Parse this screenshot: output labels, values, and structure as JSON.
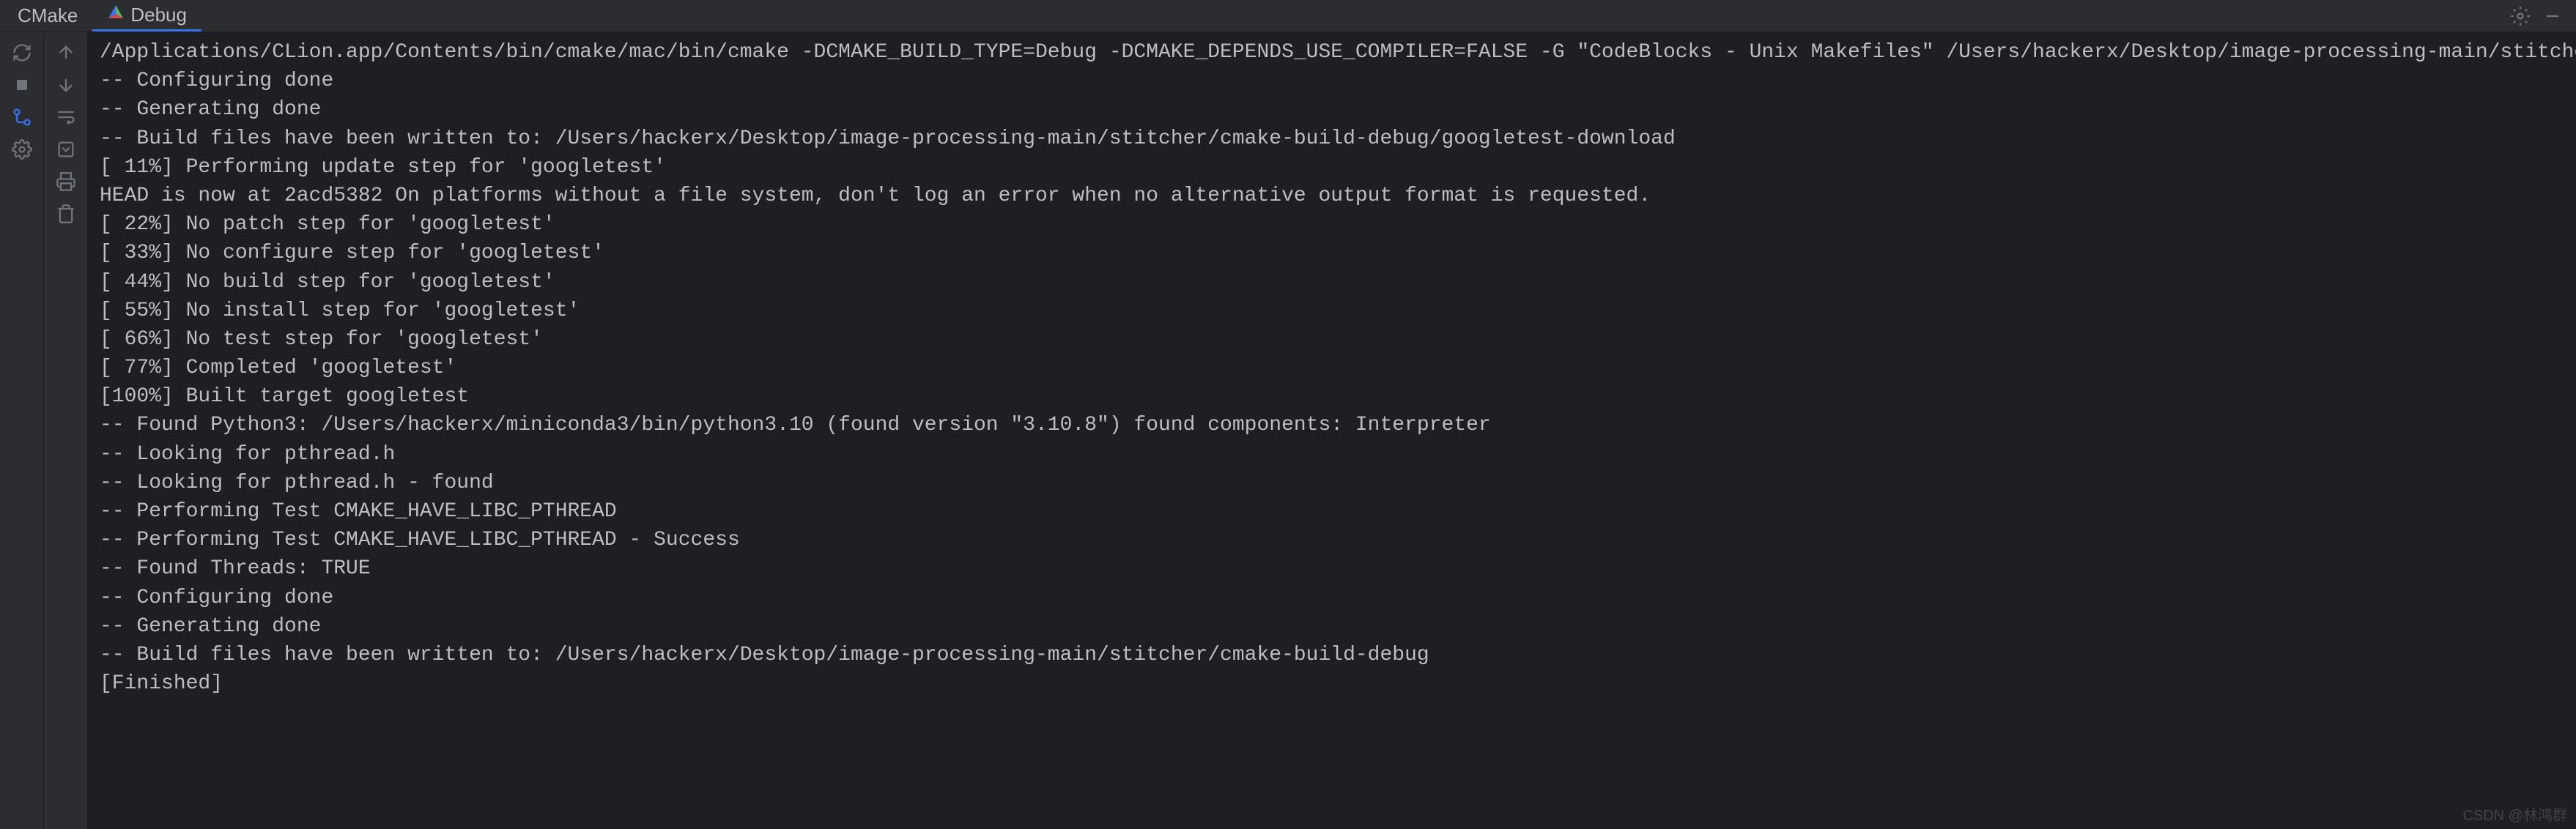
{
  "tabs": [
    {
      "label": "CMake",
      "active": false
    },
    {
      "label": "Debug",
      "active": true
    }
  ],
  "console": {
    "lines": [
      "/Applications/CLion.app/Contents/bin/cmake/mac/bin/cmake -DCMAKE_BUILD_TYPE=Debug -DCMAKE_DEPENDS_USE_COMPILER=FALSE -G \"CodeBlocks - Unix Makefiles\" /Users/hackerx/Desktop/image-processing-main/stitcher",
      "-- Configuring done",
      "-- Generating done",
      "-- Build files have been written to: /Users/hackerx/Desktop/image-processing-main/stitcher/cmake-build-debug/googletest-download",
      "[ 11%] Performing update step for 'googletest'",
      "HEAD is now at 2acd5382 On platforms without a file system, don't log an error when no alternative output format is requested.",
      "[ 22%] No patch step for 'googletest'",
      "[ 33%] No configure step for 'googletest'",
      "[ 44%] No build step for 'googletest'",
      "[ 55%] No install step for 'googletest'",
      "[ 66%] No test step for 'googletest'",
      "[ 77%] Completed 'googletest'",
      "[100%] Built target googletest",
      "-- Found Python3: /Users/hackerx/miniconda3/bin/python3.10 (found version \"3.10.8\") found components: Interpreter",
      "-- Looking for pthread.h",
      "-- Looking for pthread.h - found",
      "-- Performing Test CMAKE_HAVE_LIBC_PTHREAD",
      "-- Performing Test CMAKE_HAVE_LIBC_PTHREAD - Success",
      "-- Found Threads: TRUE",
      "-- Configuring done",
      "-- Generating done",
      "-- Build files have been written to: /Users/hackerx/Desktop/image-processing-main/stitcher/cmake-build-debug",
      "",
      "[Finished]"
    ]
  },
  "watermark": "CSDN @林鸿群"
}
